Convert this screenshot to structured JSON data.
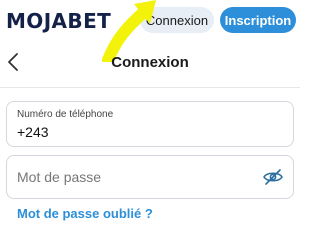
{
  "header": {
    "logo_text": "MOJABET",
    "login_label": "Connexion",
    "signup_label": "Inscription"
  },
  "page": {
    "title": "Connexion"
  },
  "form": {
    "phone": {
      "label": "Numéro de téléphone",
      "value": "+243"
    },
    "password": {
      "placeholder": "Mot de passe"
    },
    "forgot_label": "Mot de passe oublié ?"
  },
  "icons": [
    "back-chevron-icon",
    "eye-off-icon",
    "annotation-arrow"
  ],
  "colors": {
    "brand_blue": "#2d8fd9",
    "logo_navy": "#14224a",
    "arrow_yellow": "#f2f20a"
  }
}
